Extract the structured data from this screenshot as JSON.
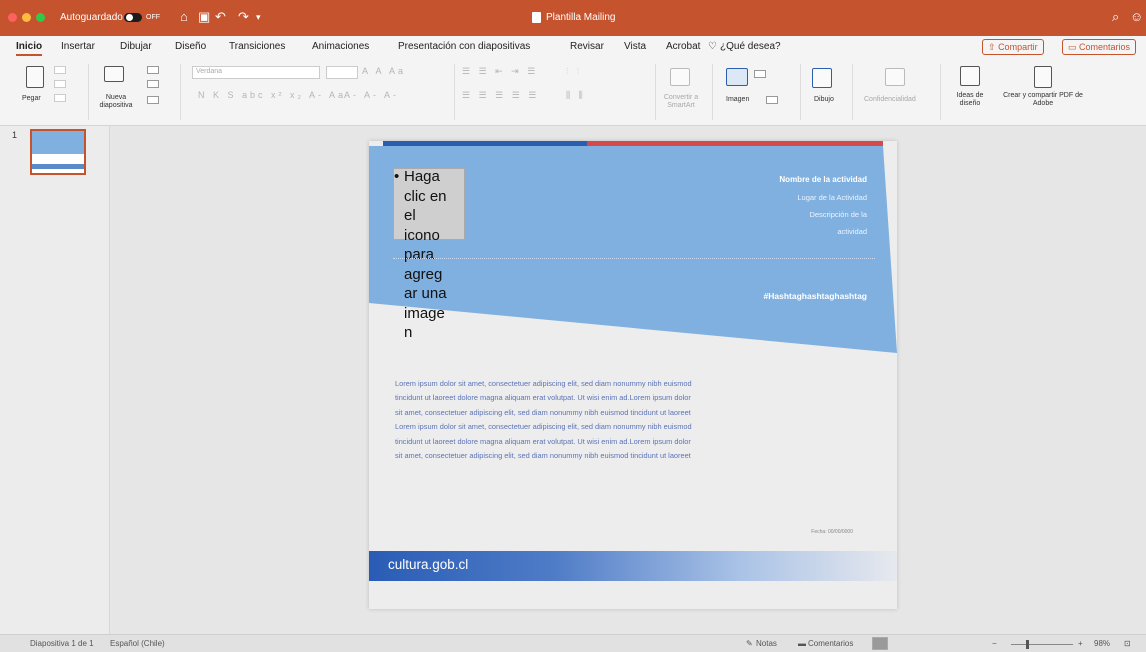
{
  "window": {
    "autosave_label": "Autoguardado",
    "autosave_state": "OFF",
    "title": "Plantilla Mailing"
  },
  "tabs": [
    "Inicio",
    "Insertar",
    "Dibujar",
    "Diseño",
    "Transiciones",
    "Animaciones",
    "Presentación con diapositivas",
    "Revisar",
    "Vista",
    "Acrobat"
  ],
  "active_tab": "Inicio",
  "tell_me": "¿Qué desea?",
  "share_label": "Compartir",
  "comments_label": "Comentarios",
  "ribbon": {
    "paste": "Pegar",
    "new_slide": "Nueva diapositiva",
    "font_name": "Verdana",
    "convert_smartart": "Convertir a SmartArt",
    "image": "Imagen",
    "draw": "Dibujo",
    "confidentiality": "Confidencialidad",
    "design_ideas": "Ideas de diseño",
    "create_pdf": "Crear y compartir PDF de Adobe"
  },
  "thumbnail": {
    "number": "1"
  },
  "slide": {
    "placeholder_bullet": "•",
    "placeholder_lines": [
      "Haga",
      "clic en",
      "el",
      "icono",
      "para",
      "agreg",
      "ar una",
      "image",
      "n"
    ],
    "activity_name": "Nombre de la actividad",
    "activity_place": "Lugar de la Actividad",
    "activity_description_1": "Descripción de la",
    "activity_description_2": "actividad",
    "hashtag": "#Hashtaghashtaghashtag",
    "lorem_lines": [
      "Lorem ipsum dolor sit amet, consectetuer adipiscing elit, sed diam nonummy nibh euismod",
      "tincidunt ut laoreet dolore magna aliquam erat volutpat. Ut wisi enim ad.Lorem ipsum dolor",
      "sit amet, consectetuer adipiscing elit, sed diam nonummy nibh euismod tincidunt ut laoreet",
      "Lorem ipsum dolor sit amet, consectetuer adipiscing elit, sed diam nonummy nibh euismod",
      "tincidunt ut laoreet dolore magna aliquam erat volutpat. Ut wisi enim ad.Lorem ipsum dolor",
      "sit amet, consectetuer adipiscing elit, sed diam nonummy nibh euismod tincidunt ut laoreet"
    ],
    "small_date": "Fecha: 00/00/0000",
    "footer": "cultura.gob.cl"
  },
  "statusbar": {
    "slide_count": "Diapositiva 1 de 1",
    "language": "Español (Chile)",
    "notes": "Notas",
    "comments": "Comentarios",
    "zoom": "98%"
  },
  "colors": {
    "titlebar": "#c4532e",
    "band": "#7fb0e0",
    "footer": "#2a5cb5"
  }
}
